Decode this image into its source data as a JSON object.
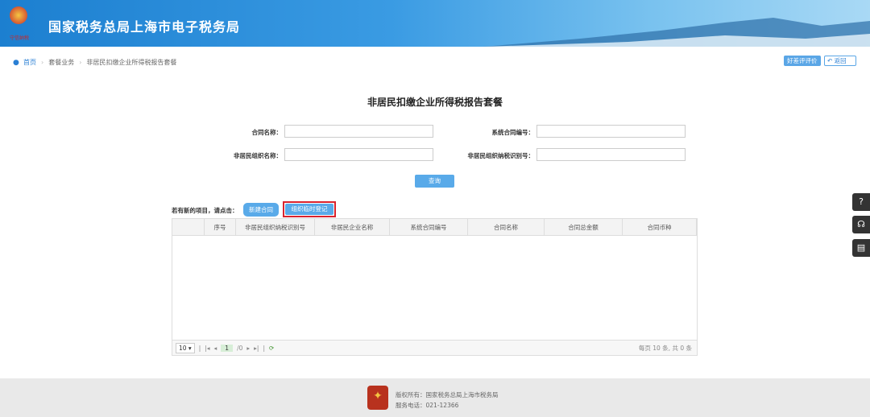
{
  "header": {
    "title": "国家税务总局上海市电子税务局",
    "logo_sub": "守信纳税"
  },
  "breadcrumb": [
    "首页",
    "套餐业务",
    "非居民扣缴企业所得税报告套餐"
  ],
  "top_buttons": {
    "rate": "好差评评价",
    "back": "返回"
  },
  "page_title": "非居民扣缴企业所得税报告套餐",
  "form": {
    "contract_name": "合同名称：",
    "system_contract_no": "系统合同编号：",
    "org_name": "非居民组织名称：",
    "org_tax_id": "非居民组织纳税识别号："
  },
  "query_button": "查询",
  "actions": {
    "prompt": "若有新的项目，请点击：",
    "new_contract": "新建合同",
    "temp_register": "组织临时登记"
  },
  "table": {
    "columns": [
      "",
      "序号",
      "非居民组织纳税识别号",
      "非居民企业名称",
      "系统合同编号",
      "合同名称",
      "合同总金额",
      "合同币种"
    ],
    "rows": []
  },
  "pager": {
    "page_size": "10",
    "page": "1",
    "total_pages": "/0",
    "info": "每页 10 条, 共 0 条"
  },
  "side_icons": [
    "help-icon",
    "customer-service-icon",
    "manual-icon"
  ],
  "footer": {
    "copyright": "版权所有：国家税务总局上海市税务局",
    "phone": "服务电话：021-12366"
  }
}
